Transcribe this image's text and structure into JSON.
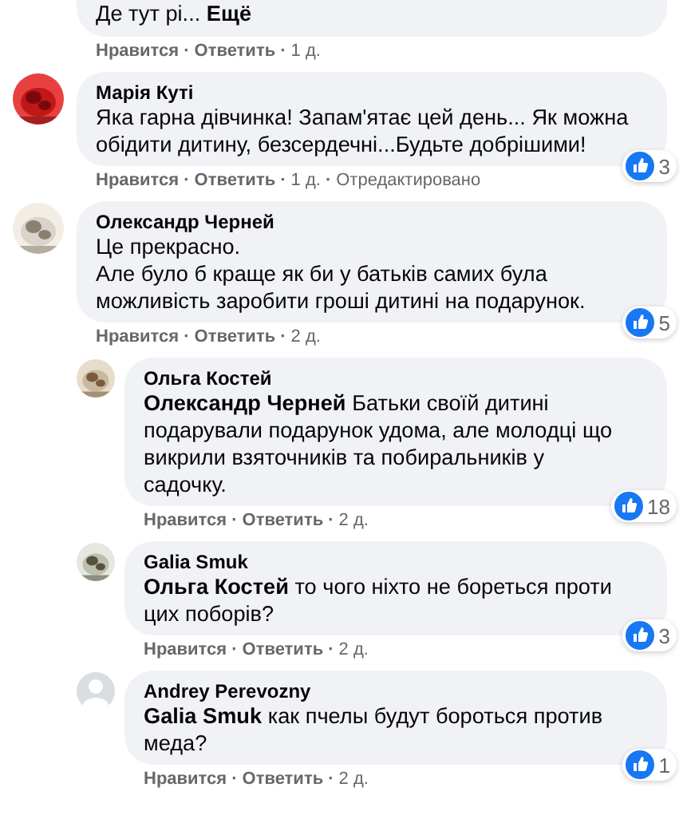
{
  "comments": [
    {
      "text": "Де тут рі... **Ещё**",
      "meta": [
        {
          "kind": "link",
          "text": "Нравится"
        },
        {
          "kind": "dot",
          "text": "·"
        },
        {
          "kind": "link",
          "text": "Ответить"
        },
        {
          "kind": "dot",
          "text": "·"
        },
        {
          "kind": "time",
          "text": "1 д."
        }
      ]
    },
    {
      "photo": true,
      "author": "Марія Куті",
      "text": "Яка гарна дівчинка! Запам'ятає цей день... Як можна обідити дитину, безсердечні...Будьте добрішими!",
      "reactions": "3",
      "meta": [
        {
          "kind": "link",
          "text": "Нравится"
        },
        {
          "kind": "dot",
          "text": "·"
        },
        {
          "kind": "link",
          "text": "Ответить"
        },
        {
          "kind": "dot",
          "text": "·"
        },
        {
          "kind": "time",
          "text": "1 д."
        },
        {
          "kind": "dot",
          "text": "·"
        },
        {
          "kind": "plain",
          "text": "Отредактировано"
        }
      ]
    },
    {
      "photo": true,
      "author": "Олександр Черней",
      "text": "Це прекрасно.\nАле було б краще як би у батьків самих була можливість заробити гроші дитині на подарунок.",
      "reactions": "5",
      "meta": [
        {
          "kind": "link",
          "text": "Нравится"
        },
        {
          "kind": "dot",
          "text": "·"
        },
        {
          "kind": "link",
          "text": "Ответить"
        },
        {
          "kind": "dot",
          "text": "·"
        },
        {
          "kind": "time",
          "text": "2 д."
        }
      ],
      "children": [
        {
          "photo": true,
          "author": "Ольга Костей",
          "text": "**Олександр Черней** Батьки своїй дитині подарували подарунок удома, але молодці що викрили взяточників та побиральників у садочку.",
          "reactions": "18",
          "meta": [
            {
              "kind": "link",
              "text": "Нравится"
            },
            {
              "kind": "dot",
              "text": "·"
            },
            {
              "kind": "link",
              "text": "Ответить"
            },
            {
              "kind": "dot",
              "text": "·"
            },
            {
              "kind": "time",
              "text": "2 д."
            }
          ]
        },
        {
          "photo": true,
          "author": "Galia Smuk",
          "text": "**Ольга Костей** то чого ніхто не бореться проти цих поборів?",
          "reactions": "3",
          "meta": [
            {
              "kind": "link",
              "text": "Нравится"
            },
            {
              "kind": "dot",
              "text": "·"
            },
            {
              "kind": "link",
              "text": "Ответить"
            },
            {
              "kind": "dot",
              "text": "·"
            },
            {
              "kind": "time",
              "text": "2 д."
            }
          ]
        },
        {
          "photo": false,
          "author": "Andrey Perevozny",
          "text": "**Galia Smuk** как пчелы будут бороться против меда?",
          "reactions": "1",
          "meta": [
            {
              "kind": "link",
              "text": "Нравится"
            },
            {
              "kind": "dot",
              "text": "·"
            },
            {
              "kind": "link",
              "text": "Ответить"
            },
            {
              "kind": "dot",
              "text": "·"
            },
            {
              "kind": "time",
              "text": "2 д."
            }
          ]
        }
      ]
    }
  ]
}
